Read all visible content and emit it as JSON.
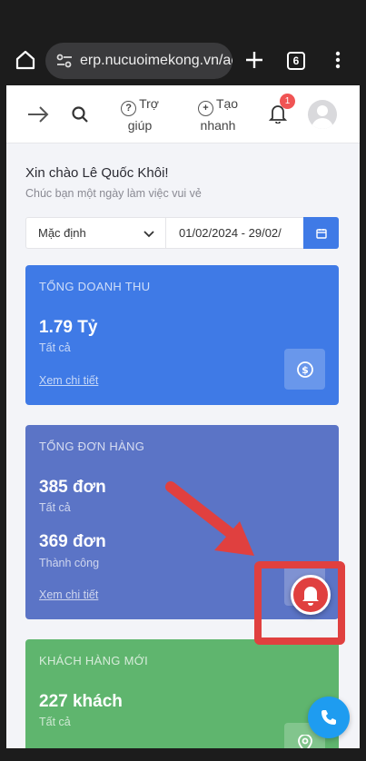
{
  "browser": {
    "url": "erp.nucuoimekong.vn/ad",
    "tab_count": "6"
  },
  "topnav": {
    "help_label_1": "Trợ",
    "help_label_2": "giúp",
    "create_label_1": "Tạo",
    "create_label_2": "nhanh",
    "notification_count": "1"
  },
  "greeting": {
    "title": "Xin chào Lê Quốc Khôi!",
    "subtitle": "Chúc bạn một ngày làm việc vui vẻ"
  },
  "filter": {
    "period_selected": "Mặc định",
    "date_range": "01/02/2024 - 29/02/"
  },
  "cards": {
    "revenue": {
      "title": "TỔNG DOANH THU",
      "value": "1.79 Tỷ",
      "caption": "Tất cả",
      "link": "Xem chi tiết",
      "color": "#3f7ae6"
    },
    "orders": {
      "title": "TỔNG ĐƠN HÀNG",
      "value_all": "385 đơn",
      "caption_all": "Tất cả",
      "value_success": "369 đơn",
      "caption_success": "Thành công",
      "link": "Xem chi tiết",
      "color": "#5b74c6"
    },
    "customers": {
      "title": "KHÁCH HÀNG MỚI",
      "value": "227 khách",
      "caption": "Tất cả",
      "color": "#5fb56e"
    }
  },
  "icons": [
    "home-icon",
    "site-settings-icon",
    "new-tab-icon",
    "tab-switcher-icon",
    "more-menu-icon",
    "arrow-right-icon",
    "search-icon",
    "help-icon",
    "plus-circle-icon",
    "bell-icon",
    "avatar",
    "chevron-down-icon",
    "calendar-icon",
    "dollar-icon",
    "map-pin-icon",
    "alert-bell-icon",
    "phone-icon"
  ],
  "annotation_color": "#e0403f"
}
